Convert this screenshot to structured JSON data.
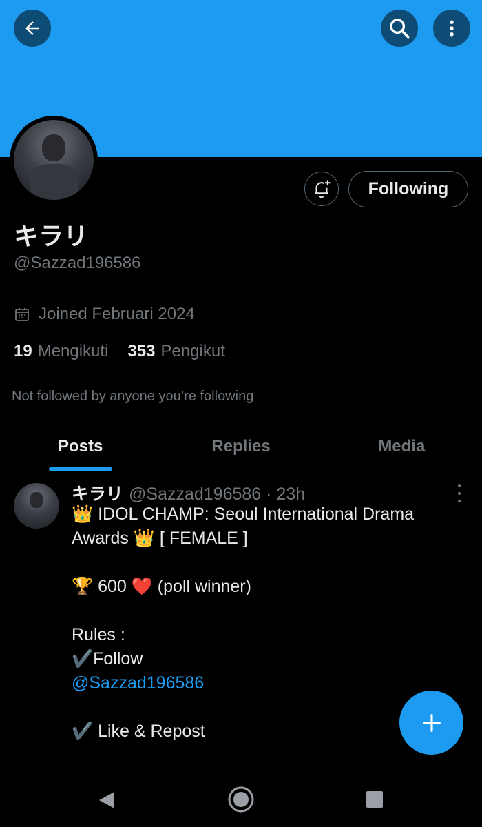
{
  "colors": {
    "banner": "#1d9bf0",
    "accent": "#1d9bf0",
    "background": "#000000",
    "text_primary": "#e7e9ea",
    "text_secondary": "#71767b",
    "border": "#2f3336"
  },
  "header": {
    "back_icon": "arrow-left-icon",
    "search_icon": "search-icon",
    "more_icon": "more-vertical-icon"
  },
  "profile": {
    "display_name": "キラリ",
    "handle": "@Sazzad196586",
    "joined": "Joined Februari 2024",
    "following_count": "19",
    "following_label": "Mengikuti",
    "followers_count": "353",
    "followers_label": "Pengikut",
    "not_followed_note": "Not followed by anyone you’re following",
    "follow_button_label": "Following",
    "notify_icon": "bell-plus-icon"
  },
  "tabs": [
    {
      "label": "Posts",
      "active": true
    },
    {
      "label": "Replies",
      "active": false
    },
    {
      "label": "Media",
      "active": false
    }
  ],
  "post": {
    "name": "キラリ",
    "meta": "@Sazzad196586 · 23h",
    "lines": [
      "👑 IDOL CHAMP: Seoul International Drama",
      "Awards 👑 [ FEMALE ]",
      "",
      "🏆 600 ❤️ (poll winner)",
      "",
      "Rules :",
      "✔️Follow"
    ],
    "mention": "@Sazzad196586",
    "after_lines": [
      "",
      "✔️ Like & Repost"
    ]
  },
  "fab_icon": "plus-icon",
  "system_nav": {
    "back_icon": "triangle-back-icon",
    "home_icon": "circle-home-icon",
    "recents_icon": "square-recents-icon"
  }
}
